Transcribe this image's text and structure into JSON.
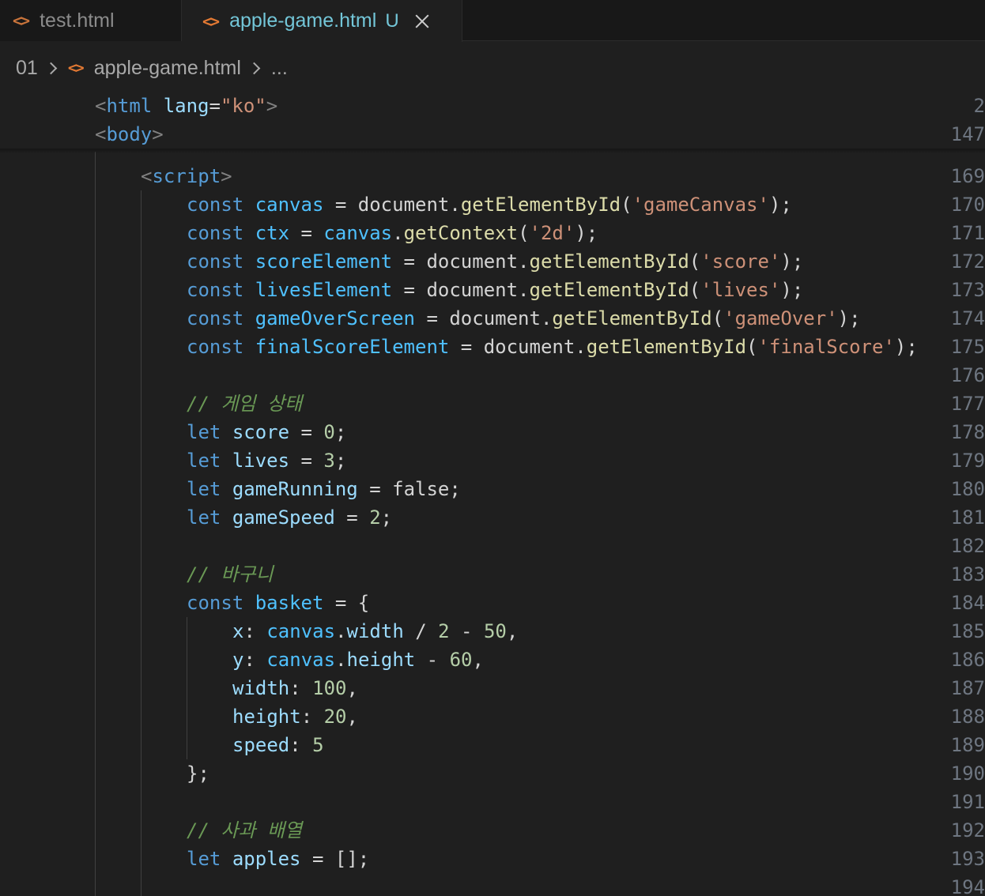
{
  "tabs": [
    {
      "icon": "<>",
      "title": "test.html",
      "active": false
    },
    {
      "icon": "<>",
      "title": "apple-game.html",
      "modified": "U",
      "active": true
    }
  ],
  "breadcrumb": {
    "folder": "01",
    "file": "apple-game.html",
    "more": "..."
  },
  "sticky_lines": [
    {
      "num": "2",
      "tokens": [
        [
          "t-punc",
          "<"
        ],
        [
          "t-tag",
          "html"
        ],
        [
          "t-plain",
          " "
        ],
        [
          "t-attr",
          "lang"
        ],
        [
          "t-plain",
          "="
        ],
        [
          "t-str",
          "\"ko\""
        ],
        [
          "t-punc",
          ">"
        ]
      ]
    },
    {
      "num": "147",
      "tokens": [
        [
          "t-punc",
          "<"
        ],
        [
          "t-tag",
          "body"
        ],
        [
          "t-punc",
          ">"
        ]
      ]
    }
  ],
  "lines": [
    {
      "num": "169",
      "indent": 1,
      "tokens": [
        [
          "t-punc",
          "<"
        ],
        [
          "t-tag",
          "script"
        ],
        [
          "t-punc",
          ">"
        ]
      ]
    },
    {
      "num": "170",
      "indent": 2,
      "tokens": [
        [
          "t-kw",
          "const"
        ],
        [
          "t-plain",
          " "
        ],
        [
          "t-const",
          "canvas"
        ],
        [
          "t-op",
          " = "
        ],
        [
          "t-plain",
          "document."
        ],
        [
          "t-fn",
          "getElementById"
        ],
        [
          "t-plain",
          "("
        ],
        [
          "t-str",
          "'gameCanvas'"
        ],
        [
          "t-plain",
          ");"
        ]
      ]
    },
    {
      "num": "171",
      "indent": 2,
      "tokens": [
        [
          "t-kw",
          "const"
        ],
        [
          "t-plain",
          " "
        ],
        [
          "t-const",
          "ctx"
        ],
        [
          "t-op",
          " = "
        ],
        [
          "t-const",
          "canvas"
        ],
        [
          "t-plain",
          "."
        ],
        [
          "t-fn",
          "getContext"
        ],
        [
          "t-plain",
          "("
        ],
        [
          "t-str",
          "'2d'"
        ],
        [
          "t-plain",
          ");"
        ]
      ]
    },
    {
      "num": "172",
      "indent": 2,
      "tokens": [
        [
          "t-kw",
          "const"
        ],
        [
          "t-plain",
          " "
        ],
        [
          "t-const",
          "scoreElement"
        ],
        [
          "t-op",
          " = "
        ],
        [
          "t-plain",
          "document."
        ],
        [
          "t-fn",
          "getElementById"
        ],
        [
          "t-plain",
          "("
        ],
        [
          "t-str",
          "'score'"
        ],
        [
          "t-plain",
          ");"
        ]
      ]
    },
    {
      "num": "173",
      "indent": 2,
      "tokens": [
        [
          "t-kw",
          "const"
        ],
        [
          "t-plain",
          " "
        ],
        [
          "t-const",
          "livesElement"
        ],
        [
          "t-op",
          " = "
        ],
        [
          "t-plain",
          "document."
        ],
        [
          "t-fn",
          "getElementById"
        ],
        [
          "t-plain",
          "("
        ],
        [
          "t-str",
          "'lives'"
        ],
        [
          "t-plain",
          ");"
        ]
      ]
    },
    {
      "num": "174",
      "indent": 2,
      "tokens": [
        [
          "t-kw",
          "const"
        ],
        [
          "t-plain",
          " "
        ],
        [
          "t-const",
          "gameOverScreen"
        ],
        [
          "t-op",
          " = "
        ],
        [
          "t-plain",
          "document."
        ],
        [
          "t-fn",
          "getElementById"
        ],
        [
          "t-plain",
          "("
        ],
        [
          "t-str",
          "'gameOver'"
        ],
        [
          "t-plain",
          ");"
        ]
      ]
    },
    {
      "num": "175",
      "indent": 2,
      "tokens": [
        [
          "t-kw",
          "const"
        ],
        [
          "t-plain",
          " "
        ],
        [
          "t-const",
          "finalScoreElement"
        ],
        [
          "t-op",
          " = "
        ],
        [
          "t-plain",
          "document."
        ],
        [
          "t-fn",
          "getElementById"
        ],
        [
          "t-plain",
          "("
        ],
        [
          "t-str",
          "'finalScore'"
        ],
        [
          "t-plain",
          ");"
        ]
      ]
    },
    {
      "num": "176",
      "indent": 2,
      "tokens": []
    },
    {
      "num": "177",
      "indent": 2,
      "tokens": [
        [
          "t-cmt",
          "// 게임 상태"
        ]
      ]
    },
    {
      "num": "178",
      "indent": 2,
      "tokens": [
        [
          "t-kw",
          "let"
        ],
        [
          "t-plain",
          " "
        ],
        [
          "t-var",
          "score"
        ],
        [
          "t-op",
          " = "
        ],
        [
          "t-num",
          "0"
        ],
        [
          "t-plain",
          ";"
        ]
      ]
    },
    {
      "num": "179",
      "indent": 2,
      "tokens": [
        [
          "t-kw",
          "let"
        ],
        [
          "t-plain",
          " "
        ],
        [
          "t-var",
          "lives"
        ],
        [
          "t-op",
          " = "
        ],
        [
          "t-num",
          "3"
        ],
        [
          "t-plain",
          ";"
        ]
      ]
    },
    {
      "num": "180",
      "indent": 2,
      "tokens": [
        [
          "t-kw",
          "let"
        ],
        [
          "t-plain",
          " "
        ],
        [
          "t-var",
          "gameRunning"
        ],
        [
          "t-op",
          " = "
        ],
        [
          "t-plain",
          "false;"
        ]
      ]
    },
    {
      "num": "181",
      "indent": 2,
      "tokens": [
        [
          "t-kw",
          "let"
        ],
        [
          "t-plain",
          " "
        ],
        [
          "t-var",
          "gameSpeed"
        ],
        [
          "t-op",
          " = "
        ],
        [
          "t-num",
          "2"
        ],
        [
          "t-plain",
          ";"
        ]
      ]
    },
    {
      "num": "182",
      "indent": 2,
      "tokens": []
    },
    {
      "num": "183",
      "indent": 2,
      "tokens": [
        [
          "t-cmt",
          "// 바구니"
        ]
      ]
    },
    {
      "num": "184",
      "indent": 2,
      "tokens": [
        [
          "t-kw",
          "const"
        ],
        [
          "t-plain",
          " "
        ],
        [
          "t-const",
          "basket"
        ],
        [
          "t-op",
          " = "
        ],
        [
          "t-plain",
          "{"
        ]
      ]
    },
    {
      "num": "185",
      "indent": 3,
      "tokens": [
        [
          "t-prop",
          "x"
        ],
        [
          "t-plain",
          ": "
        ],
        [
          "t-const",
          "canvas"
        ],
        [
          "t-plain",
          "."
        ],
        [
          "t-prop",
          "width"
        ],
        [
          "t-op",
          " / "
        ],
        [
          "t-num",
          "2"
        ],
        [
          "t-op",
          " - "
        ],
        [
          "t-num",
          "50"
        ],
        [
          "t-plain",
          ","
        ]
      ]
    },
    {
      "num": "186",
      "indent": 3,
      "tokens": [
        [
          "t-prop",
          "y"
        ],
        [
          "t-plain",
          ": "
        ],
        [
          "t-const",
          "canvas"
        ],
        [
          "t-plain",
          "."
        ],
        [
          "t-prop",
          "height"
        ],
        [
          "t-op",
          " - "
        ],
        [
          "t-num",
          "60"
        ],
        [
          "t-plain",
          ","
        ]
      ]
    },
    {
      "num": "187",
      "indent": 3,
      "tokens": [
        [
          "t-prop",
          "width"
        ],
        [
          "t-plain",
          ": "
        ],
        [
          "t-num",
          "100"
        ],
        [
          "t-plain",
          ","
        ]
      ]
    },
    {
      "num": "188",
      "indent": 3,
      "tokens": [
        [
          "t-prop",
          "height"
        ],
        [
          "t-plain",
          ": "
        ],
        [
          "t-num",
          "20"
        ],
        [
          "t-plain",
          ","
        ]
      ]
    },
    {
      "num": "189",
      "indent": 3,
      "tokens": [
        [
          "t-prop",
          "speed"
        ],
        [
          "t-plain",
          ": "
        ],
        [
          "t-num",
          "5"
        ]
      ]
    },
    {
      "num": "190",
      "indent": 2,
      "tokens": [
        [
          "t-plain",
          "};"
        ]
      ]
    },
    {
      "num": "191",
      "indent": 2,
      "tokens": []
    },
    {
      "num": "192",
      "indent": 2,
      "tokens": [
        [
          "t-cmt",
          "// 사과 배열"
        ]
      ]
    },
    {
      "num": "193",
      "indent": 2,
      "tokens": [
        [
          "t-kw",
          "let"
        ],
        [
          "t-plain",
          " "
        ],
        [
          "t-var",
          "apples"
        ],
        [
          "t-op",
          " = "
        ],
        [
          "t-plain",
          "[];"
        ]
      ]
    },
    {
      "num": "194",
      "indent": 2,
      "tokens": []
    }
  ]
}
